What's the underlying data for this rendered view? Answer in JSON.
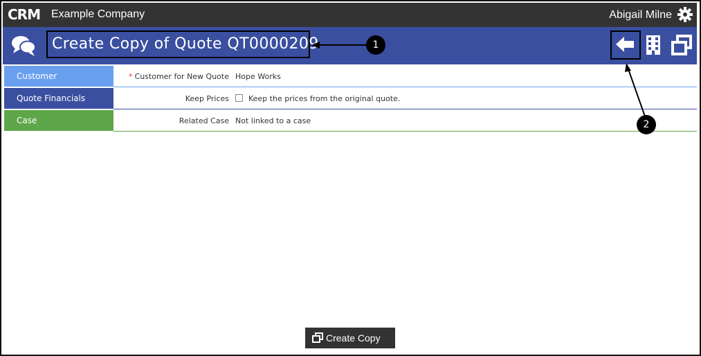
{
  "app": {
    "logo_text": "CRM",
    "company": "Example Company",
    "user": "Abigail Milne"
  },
  "page": {
    "title": "Create Copy of Quote QT0000209"
  },
  "sections": [
    {
      "tab": "Customer",
      "color": "#6a9ff0",
      "label": "Customer for New Quote",
      "required": "*",
      "value": "Hope Works"
    },
    {
      "tab": "Quote Financials",
      "color": "#3a4fa0",
      "label": "Keep Prices",
      "value": "Keep the prices from the original quote.",
      "checked": false
    },
    {
      "tab": "Case",
      "color": "#5ea64a",
      "label": "Related Case",
      "value": "Not linked to a case"
    }
  ],
  "annotations": [
    "1",
    "2"
  ],
  "footer": {
    "create_copy_label": "Create Copy"
  },
  "icons": [
    "crm-logo",
    "gear-icon",
    "chat-icon",
    "back-arrow-icon",
    "building-icon",
    "copy-icon"
  ]
}
